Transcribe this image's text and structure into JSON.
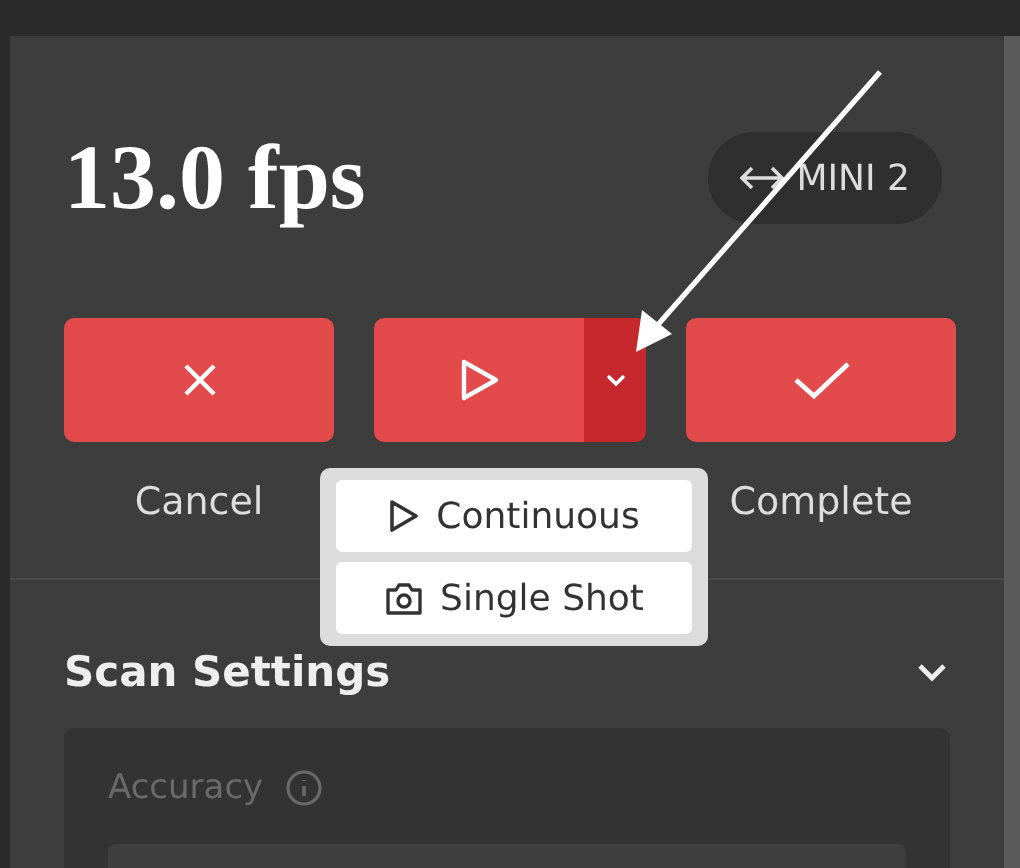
{
  "fps": "13.0 fps",
  "device": {
    "label": "MINI 2"
  },
  "actions": [
    {
      "kind": "cancel",
      "label": "Cancel"
    },
    {
      "kind": "scan"
    },
    {
      "kind": "complete",
      "label": "Complete"
    }
  ],
  "dropdown": {
    "open": true,
    "items": [
      {
        "kind": "continuous",
        "label": "Continuous"
      },
      {
        "kind": "single",
        "label": "Single Shot"
      }
    ]
  },
  "section": {
    "title": "Scan Settings",
    "expanded": true
  },
  "accuracy": {
    "label": "Accuracy"
  }
}
